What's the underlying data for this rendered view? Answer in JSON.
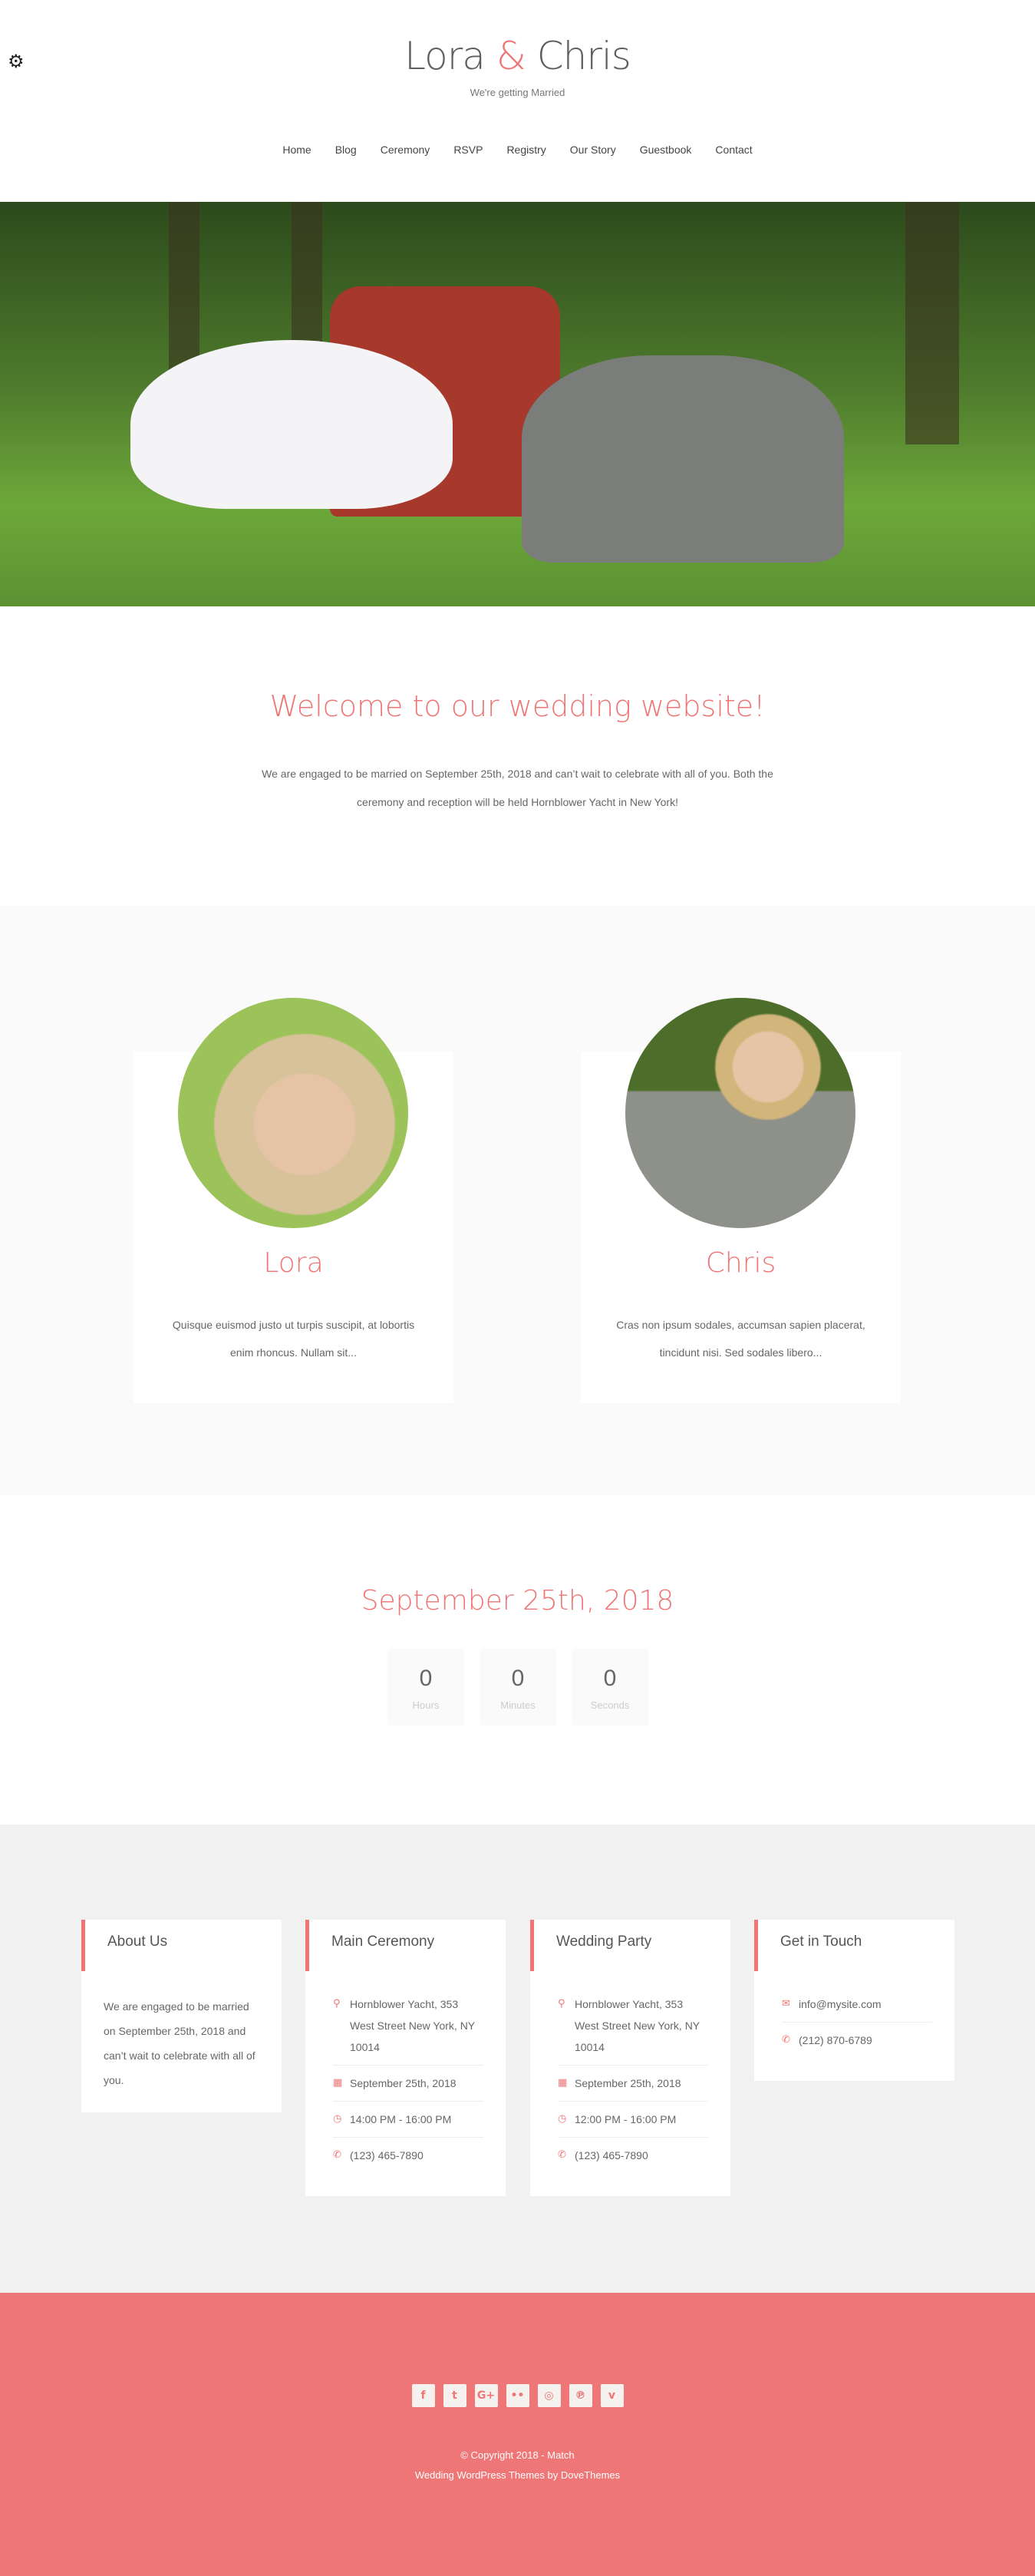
{
  "site": {
    "name_part1": "Lora ",
    "ampersand": "&",
    "name_part2": " Chris",
    "tagline": "We're getting Married"
  },
  "nav": [
    {
      "label": "Home"
    },
    {
      "label": "Blog"
    },
    {
      "label": "Ceremony"
    },
    {
      "label": "RSVP"
    },
    {
      "label": "Registry"
    },
    {
      "label": "Our Story"
    },
    {
      "label": "Guestbook"
    },
    {
      "label": "Contact"
    }
  ],
  "welcome": {
    "title": "Welcome to our wedding website!",
    "text": "We are engaged to be married on September 25th, 2018 and can’t wait to celebrate with all of you. Both the ceremony and reception will be held Hornblower Yacht in New York!"
  },
  "couple": [
    {
      "name": "Lora",
      "bio": "Quisque euismod justo ut turpis suscipit, at lobortis enim rhoncus. Nullam sit..."
    },
    {
      "name": "Chris",
      "bio": "Cras non ipsum sodales, accumsan sapien placerat, tincidunt nisi. Sed sodales libero..."
    }
  ],
  "countdown": {
    "date": "September 25th, 2018",
    "units": [
      {
        "value": "0",
        "label": "Hours"
      },
      {
        "value": "0",
        "label": "Minutes"
      },
      {
        "value": "0",
        "label": "Seconds"
      }
    ]
  },
  "widgets": {
    "about": {
      "title": "About Us",
      "text": "We are engaged to be married on September 25th, 2018 and can’t wait to celebrate with all of you."
    },
    "ceremony": {
      "title": "Main Ceremony",
      "address": "Hornblower Yacht, 353 West Street New York, NY 10014",
      "date": "September 25th, 2018",
      "time": "14:00 PM - 16:00 PM",
      "phone": "(123) 465-7890"
    },
    "party": {
      "title": "Wedding Party",
      "address": "Hornblower Yacht, 353 West Street New York, NY 10014",
      "date": "September 25th, 2018",
      "time": "12:00 PM - 16:00 PM",
      "phone": "(123) 465-7890"
    },
    "contact": {
      "title": "Get in Touch",
      "email": "info@mysite.com",
      "phone": "(212) 870-6789"
    }
  },
  "footer": {
    "social": [
      "facebook-icon",
      "twitter-icon",
      "google-plus-icon",
      "flickr-icon",
      "instagram-icon",
      "pinterest-icon",
      "vimeo-icon"
    ],
    "copyright": "© Copyright 2018 - Match",
    "credit": "Wedding WordPress Themes by DoveThemes"
  },
  "colors": {
    "accent": "#ef7575",
    "footer_bg": "#ef7676",
    "widgets_bg": "#f1f1f1",
    "couple_bg": "#fafafa"
  }
}
